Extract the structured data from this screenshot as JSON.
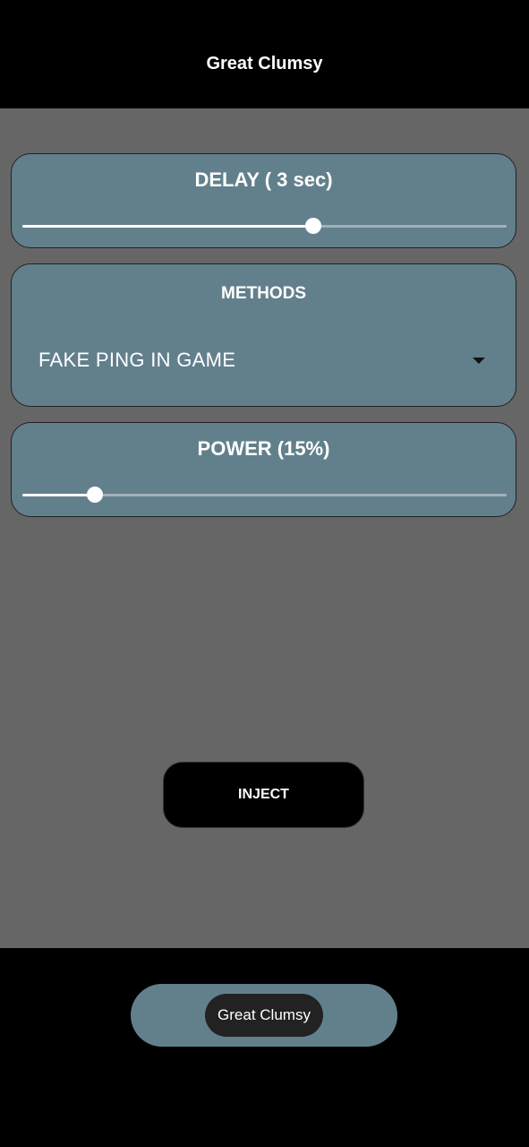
{
  "app": {
    "title": "Great Clumsy"
  },
  "delay": {
    "label": "DELAY ( 3 sec)",
    "value_fraction": 0.6
  },
  "methods": {
    "label": "METHODS",
    "selected": "FAKE PING IN GAME"
  },
  "power": {
    "label": "POWER (15%)",
    "value_fraction": 0.15
  },
  "actions": {
    "inject_label": "INJECT"
  },
  "toast": {
    "text": "Great Clumsy"
  },
  "colors": {
    "card_bg": "#62808c",
    "content_bg": "#666666",
    "bar_bg": "#000000"
  }
}
